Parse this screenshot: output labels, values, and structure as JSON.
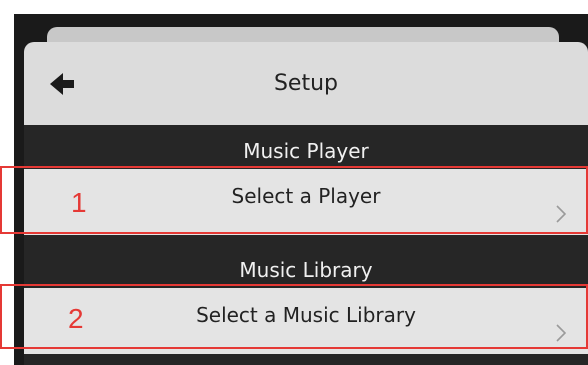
{
  "header": {
    "title": "Setup"
  },
  "sections": [
    {
      "label": "Music Player",
      "row_label": "Select a Player",
      "step": "1"
    },
    {
      "label": "Music Library",
      "row_label": "Select a Music Library",
      "step": "2"
    }
  ],
  "colors": {
    "highlight": "#e53935",
    "panel_dark": "#262626",
    "row_light": "#e4e4e4",
    "header_light": "#dcdcdc"
  },
  "icons": {
    "back": "arrow-left-icon",
    "row_chevron": "chevron-right-icon"
  }
}
